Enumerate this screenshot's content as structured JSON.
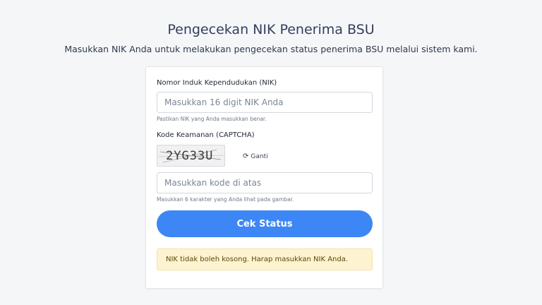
{
  "header": {
    "title": "Pengecekan NIK Penerima BSU",
    "subtitle": "Masukkan NIK Anda untuk melakukan pengecekan status penerima BSU melalui sistem kami."
  },
  "form": {
    "nik": {
      "label": "Nomor Induk Kependudukan (NIK)",
      "placeholder": "Masukkan 16 digit NIK Anda",
      "value": "",
      "hint": "Pastikan NIK yang Anda masukkan benar."
    },
    "captcha": {
      "label": "Kode Keamanan (CAPTCHA)",
      "code": "2YG33U",
      "refresh_icon": "refresh-icon",
      "refresh_label": "Ganti",
      "placeholder": "Masukkan kode di atas",
      "value": "",
      "hint": "Masukkan 6 karakter yang Anda lihat pada gambar."
    },
    "submit_label": "Cek Status"
  },
  "alert": {
    "message": "NIK tidak boleh kosong. Harap masukkan NIK Anda."
  },
  "colors": {
    "accent": "#3d86f5",
    "warning_bg": "#fdf3d0",
    "warning_text": "#5a4708"
  }
}
